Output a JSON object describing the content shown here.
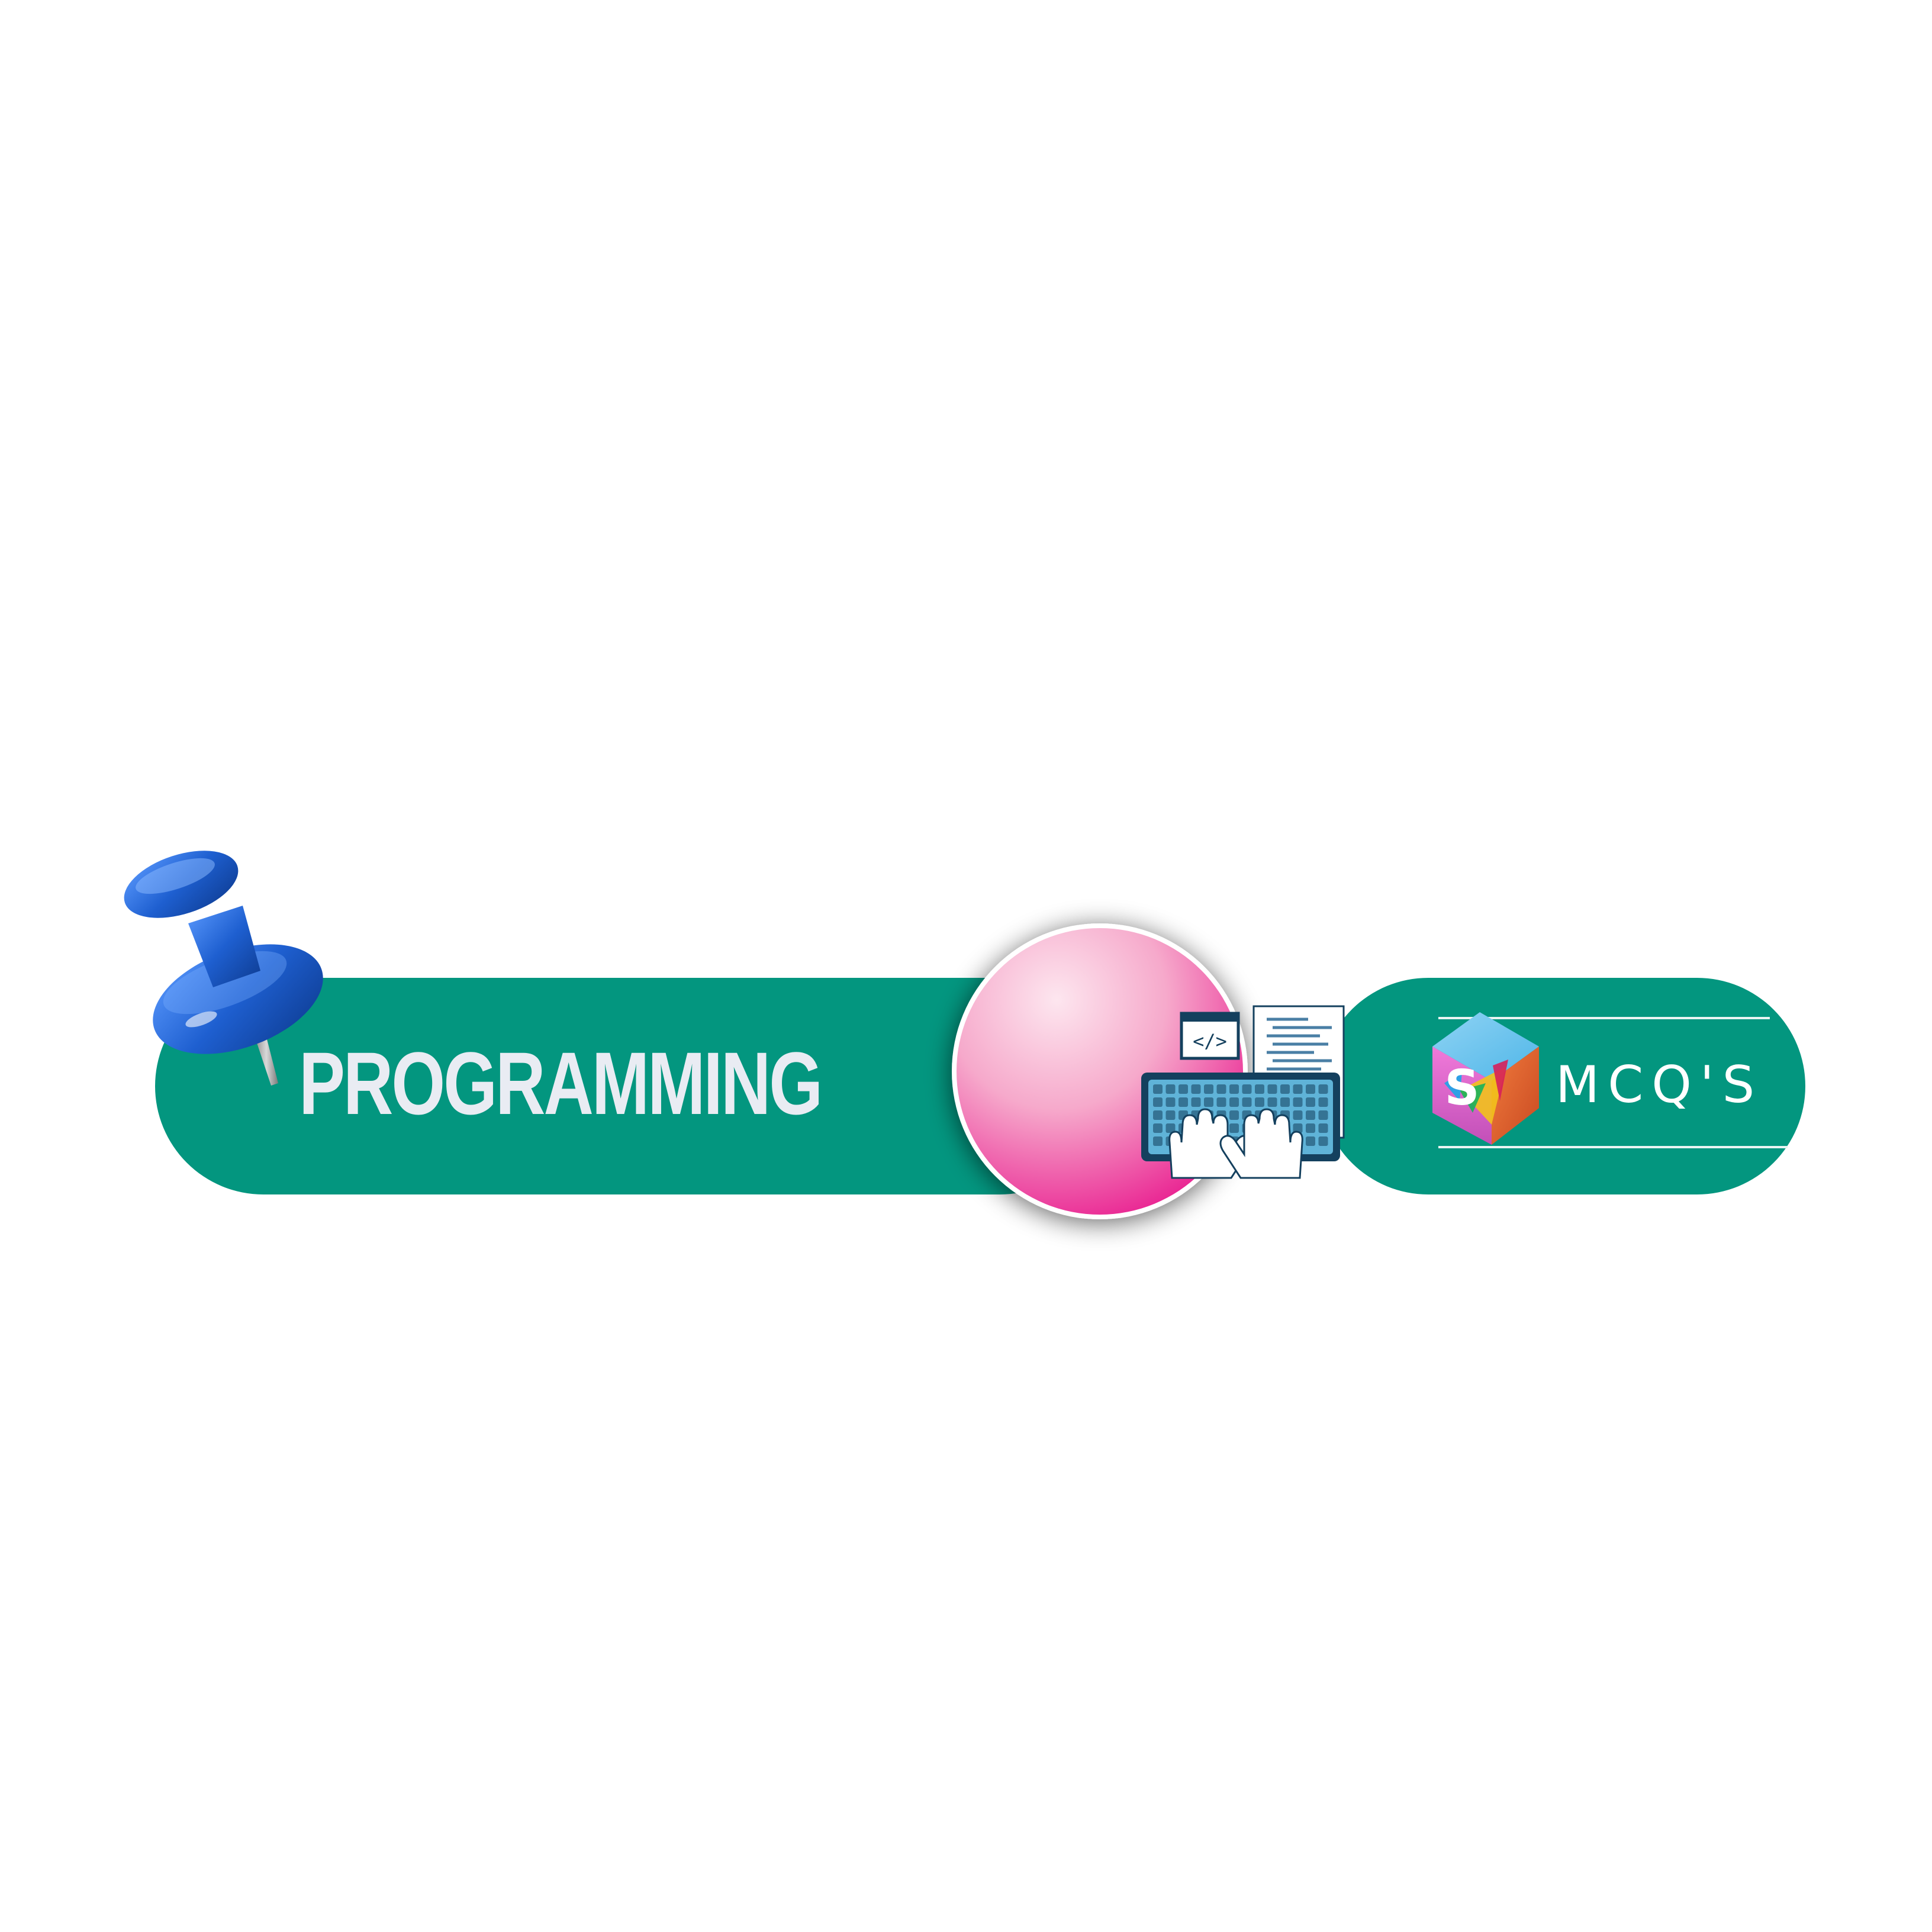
{
  "banner": {
    "title": "PROGRAMMING",
    "color": "#03967f",
    "title_color": "#e9ecf3"
  },
  "logo": {
    "letter": "S",
    "text": "MCQ'S",
    "colors": [
      "#f06fd8",
      "#e5603a",
      "#6fc3f0",
      "#1ba6e8",
      "#f2c21b",
      "#18b35a",
      "#d6205b"
    ]
  },
  "emblem": {
    "icon": "keyboard-coding-icon",
    "code_tag": "</>",
    "gradient": [
      "#fde6ef",
      "#e8168c"
    ]
  },
  "pin": {
    "icon": "pushpin-icon",
    "color": "#1e5fd0"
  }
}
